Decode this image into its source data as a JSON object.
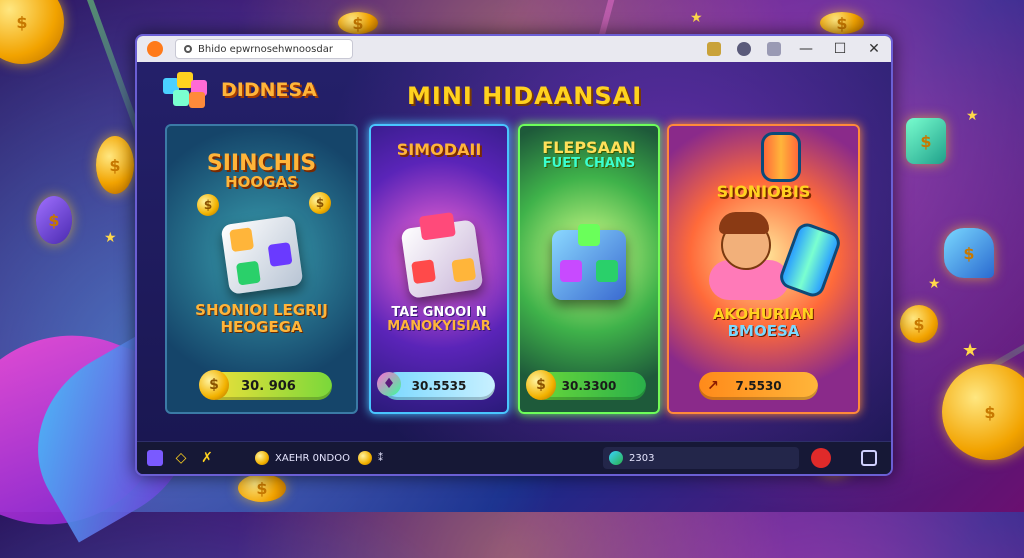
{
  "titlebar": {
    "address": "Bhido epwrnosehwnoosdar",
    "buttons": {
      "minimize": "—",
      "maximize": "☐",
      "close": "✕"
    }
  },
  "brand": {
    "name": "DIDNESA"
  },
  "game_title": "MINI HIDAANSAI",
  "cards": [
    {
      "title_line1": "SIINCHIS",
      "title_line2": "HOOGAS",
      "subtitle_line1": "SHONIOI LEGRIJ",
      "subtitle_line2": "HEOGEGA",
      "price": "30. 906",
      "price_icon": "$"
    },
    {
      "title_line1": "SIMODAII",
      "title_line2": "",
      "subtitle_line1": "TAE GNOOI N",
      "subtitle_line2": "MANOKYISIAR",
      "price": "30.5535",
      "price_icon": "♦"
    },
    {
      "title_line1": "FLEPSAAN",
      "title_line2": "FUET CHANS",
      "subtitle_line1": "",
      "subtitle_line2": "",
      "price": "30.3300",
      "price_icon": "$"
    },
    {
      "title_line1": "SIONIOBIS",
      "title_line2": "",
      "subtitle_line1": "AKOHURIAN",
      "subtitle_line2": "BMOESA",
      "price": "7.5530",
      "price_icon": "↗"
    }
  ],
  "taskbar": {
    "balance_text": "XAEHR 0NDOO",
    "balance_suffix": "⁑",
    "right_count": "2303"
  }
}
